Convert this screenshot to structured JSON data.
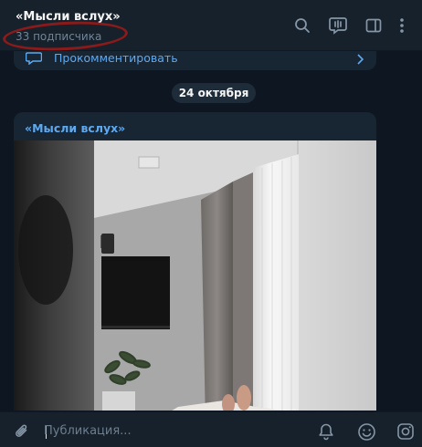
{
  "header": {
    "title": "«Мысли вслух»",
    "subtitle": "33 подписчика",
    "icons": [
      "search-icon",
      "live-stream-icon",
      "sidebar-toggle-icon",
      "more-vert-icon"
    ]
  },
  "feed": {
    "comment_label": "Прокомментировать",
    "date_separator": "24 октября",
    "post": {
      "author": "«Мысли вслух»"
    }
  },
  "composer": {
    "placeholder": "Публикация...",
    "icons": [
      "attach-icon",
      "bell-icon",
      "emoji-icon",
      "instagram-icon"
    ]
  },
  "colors": {
    "header_bg": "#17212b",
    "chat_bg": "#0e1621",
    "bubble_bg": "#182533",
    "accent": "#5ea9f0",
    "annotation": "#8b1b1b"
  }
}
